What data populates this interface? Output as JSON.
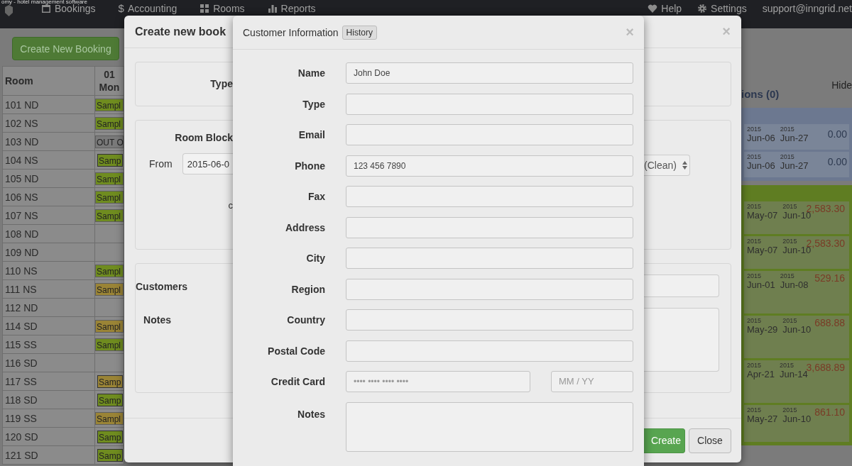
{
  "browser_title": "omy - hotel management software",
  "navbar": {
    "items": [
      {
        "label": "Bookings"
      },
      {
        "label": "Accounting",
        "glyph": "$"
      },
      {
        "label": "Rooms"
      },
      {
        "label": "Reports"
      }
    ],
    "right": [
      {
        "label": "Help"
      },
      {
        "label": "Settings"
      },
      {
        "label": "support@inngrid.net"
      }
    ]
  },
  "create_button": "Create New Booking",
  "calendar": {
    "room_heading": "Room",
    "day": "01",
    "weekday": "Mon",
    "rows": [
      {
        "room": "101 ND",
        "booking": {
          "label": "Sampl",
          "kind": "bar",
          "color": "#6f8c1f"
        }
      },
      {
        "room": "102 NS",
        "booking": {
          "label": "Sampl",
          "kind": "bar",
          "color": "#6f8c1f"
        }
      },
      {
        "room": "103 ND",
        "booking": {
          "label": "OUT O",
          "kind": "bar",
          "color": "#7a7a7a"
        }
      },
      {
        "room": "104 NS",
        "booking": {
          "label": "Samp",
          "kind": "block",
          "color": "#6f8c1f"
        }
      },
      {
        "room": "105 ND",
        "booking": {
          "label": "Sampl",
          "kind": "bar",
          "color": "#6f8c1f"
        }
      },
      {
        "room": "106 NS",
        "booking": {
          "label": "Sampl",
          "kind": "bar",
          "color": "#6f8c1f"
        }
      },
      {
        "room": "107 NS",
        "booking": {
          "label": "Sampl",
          "kind": "bar",
          "color": "#6f8c1f"
        }
      },
      {
        "room": "108 ND"
      },
      {
        "room": "109 ND"
      },
      {
        "room": "110 NS",
        "booking": {
          "label": "Sampl",
          "kind": "bar",
          "color": "#6f8c1f"
        }
      },
      {
        "room": "111 NS",
        "booking": {
          "label": "Sampl",
          "kind": "bar",
          "color": "#9a8436"
        }
      },
      {
        "room": "112 ND"
      },
      {
        "room": "114 SD",
        "booking": {
          "label": "Sampl",
          "kind": "bar",
          "color": "#9a8436"
        }
      },
      {
        "room": "115 SS",
        "booking": {
          "label": "Sampl",
          "kind": "bar",
          "color": "#6f8c1f"
        }
      },
      {
        "room": "116 SD"
      },
      {
        "room": "117 SS",
        "booking": {
          "label": "Samp",
          "kind": "block",
          "color": "#9a8436"
        }
      },
      {
        "room": "118 SD",
        "booking": {
          "label": "Samp",
          "kind": "block",
          "color": "#6f8c1f"
        }
      },
      {
        "room": "119 SS",
        "booking": {
          "label": "Sampl",
          "kind": "bar",
          "color": "#9a8436"
        }
      },
      {
        "room": "120 SD",
        "booking": {
          "label": "Samp",
          "kind": "block",
          "color": "#6f8c1f"
        }
      },
      {
        "room": "121 SD",
        "booking": {
          "label": "Samp",
          "kind": "block",
          "color": "#6f8c1f"
        }
      }
    ]
  },
  "side_panel": {
    "heading": "ions (0)",
    "hide_link": "Hide",
    "groups": [
      {
        "color": "#6c7890",
        "rows": [
          {
            "start_year": "2015",
            "start": "Jun-06",
            "end_year": "2015",
            "end": "Jun-27",
            "amount": "0.00"
          },
          {
            "start_year": "2015",
            "start": "Jun-06",
            "end_year": "2015",
            "end": "Jun-27",
            "amount": "0.00"
          }
        ]
      },
      {
        "color": "#5f7d22",
        "rows": [
          {
            "start_year": "2015",
            "start": "May-07",
            "end_year": "2015",
            "end": "Jun-10",
            "amount": "2,583.30"
          },
          {
            "start_year": "2015",
            "start": "May-07",
            "end_year": "2015",
            "end": "Jun-10",
            "amount": "2,583.30"
          },
          {
            "start_year": "2015",
            "start": "Jun-01",
            "end_year": "2015",
            "end": "Jun-08",
            "amount": "529.16"
          },
          {
            "start_year": "2015",
            "start": "May-29",
            "end_year": "2015",
            "end": "Jun-10",
            "amount": "688.88"
          },
          {
            "start_year": "2015",
            "start": "Apr-21",
            "end_year": "2015",
            "end": "Jun-14",
            "amount": "3,688.89"
          },
          {
            "start_year": "2015",
            "start": "May-27",
            "end_year": "2015",
            "end": "Jun-10",
            "amount": "861.10"
          }
        ]
      }
    ]
  },
  "booking_modal": {
    "title": "Create new book",
    "close": "×",
    "type_label": "Type",
    "room_block_label": "Room Block",
    "from_label": "From",
    "from_value": "2015-06-0",
    "fragment": "c",
    "room_select": "(Clean)",
    "customers_label": "Customers",
    "notes_label": "Notes",
    "buttons": [
      "Create",
      "Close"
    ]
  },
  "customer_modal": {
    "title": "Customer Information",
    "history_button": "History",
    "close": "×",
    "fields": [
      {
        "label": "Name",
        "kind": "input",
        "value": "John Doe"
      },
      {
        "label": "Type",
        "kind": "input"
      },
      {
        "label": "Email",
        "kind": "input"
      },
      {
        "label": "Phone",
        "kind": "input",
        "value": "123 456 7890"
      },
      {
        "label": "Fax",
        "kind": "input"
      },
      {
        "label": "Address",
        "kind": "input"
      },
      {
        "label": "City",
        "kind": "input"
      },
      {
        "label": "Region",
        "kind": "input"
      },
      {
        "label": "Country",
        "kind": "input"
      },
      {
        "label": "Postal Code",
        "kind": "input"
      },
      {
        "label": "Credit Card",
        "kind": "card",
        "placeholder": "•••• •••• •••• ••••",
        "expiry_placeholder": "MM / YY"
      },
      {
        "label": "Notes",
        "kind": "textarea"
      }
    ]
  }
}
